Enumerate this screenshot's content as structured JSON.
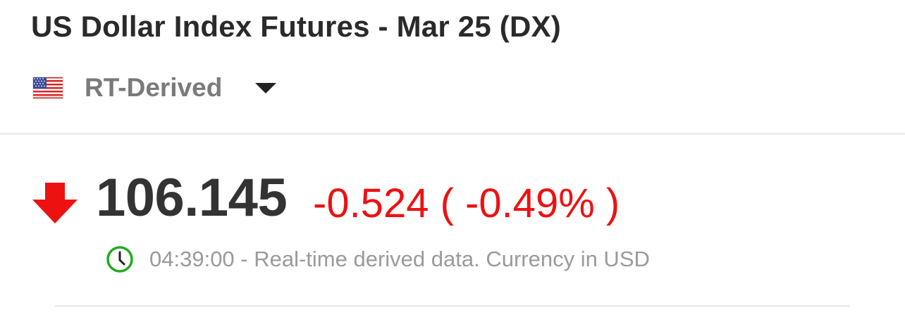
{
  "header": {
    "title": "US Dollar Index Futures - Mar 25 (DX)"
  },
  "source_selector": {
    "flag_icon": "us-flag-icon",
    "label": "RT-Derived",
    "dropdown_icon": "caret-down-icon"
  },
  "quote": {
    "direction_icon": "down-arrow-icon",
    "price": "106.145",
    "change": "-0.524",
    "change_percent": "-0.49%",
    "change_display": "-0.524 ( -0.49% )",
    "change_color": "#ee1111"
  },
  "status": {
    "clock_icon": "clock-icon",
    "text": "04:39:00 - Real-time derived data. Currency in USD",
    "clock_color": "#22aa22"
  }
}
